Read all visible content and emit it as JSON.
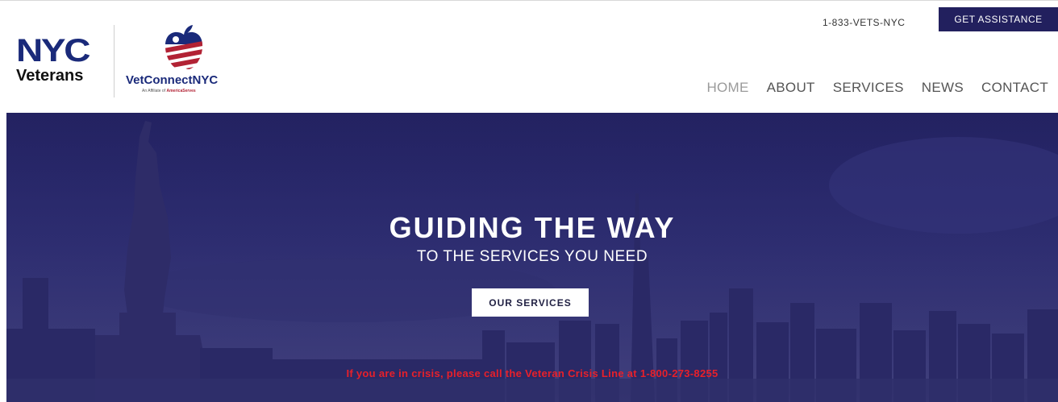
{
  "header": {
    "logo_nyc": {
      "line1": "NYC",
      "line2": "Veterans"
    },
    "logo_vetconnect": {
      "name": "VetConnectNYC",
      "affiliate_prefix": "An Affiliate of",
      "affiliate_name": "AmericaServes"
    },
    "phone": "1-833-VETS-NYC",
    "assist_label": "GET ASSISTANCE",
    "nav": [
      {
        "label": "HOME",
        "active": true
      },
      {
        "label": "ABOUT",
        "active": false
      },
      {
        "label": "SERVICES",
        "active": false
      },
      {
        "label": "NEWS",
        "active": false
      },
      {
        "label": "CONTACT",
        "active": false
      }
    ]
  },
  "hero": {
    "title": "GUIDING THE WAY",
    "subtitle": "TO THE SERVICES YOU NEED",
    "cta_label": "OUR SERVICES",
    "crisis_text": "If you are in crisis, please call the Veteran Crisis Line at 1-800-273-8255"
  },
  "colors": {
    "brand_navy": "#22205e",
    "hero_overlay": "#232261",
    "crisis_red": "#e8202a",
    "flag_red": "#b22234",
    "flag_blue": "#1a2a7a"
  },
  "icons": {
    "apple_logo": "apple-flag-icon"
  }
}
